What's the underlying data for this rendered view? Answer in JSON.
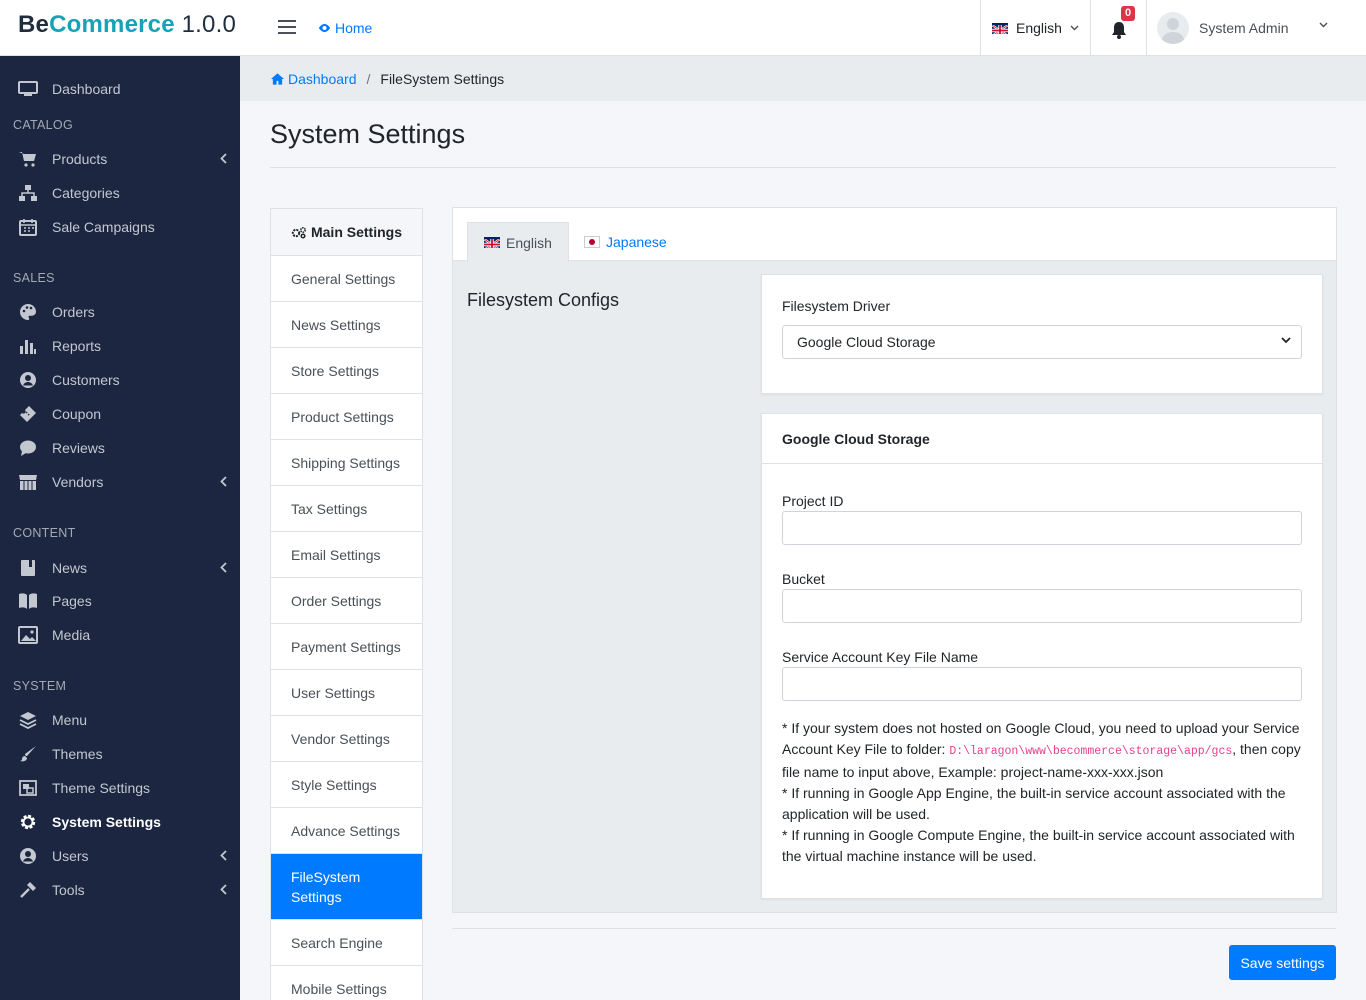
{
  "brand": {
    "name_1": "Be",
    "name_2": "Commerce",
    "version": " 1.0.0"
  },
  "topnav": {
    "home": "Home",
    "language": "English",
    "notifications_count": "0",
    "user_name": "System Admin"
  },
  "breadcrumb": {
    "root": "Dashboard",
    "current": "FileSystem Settings"
  },
  "page_title": "System Settings",
  "sidebar": {
    "dashboard": "Dashboard",
    "catalog_head": "CATALOG",
    "products": "Products",
    "categories": "Categories",
    "sale_campaigns": "Sale Campaigns",
    "sales_head": "SALES",
    "orders": "Orders",
    "reports": "Reports",
    "customers": "Customers",
    "coupon": "Coupon",
    "reviews": "Reviews",
    "vendors": "Vendors",
    "content_head": "CONTENT",
    "news": "News",
    "pages": "Pages",
    "media": "Media",
    "system_head": "SYSTEM",
    "menu": "Menu",
    "themes": "Themes",
    "theme_settings": "Theme Settings",
    "system_settings": "System Settings",
    "users": "Users",
    "tools": "Tools"
  },
  "settings_menu": {
    "title": "Main Settings",
    "items": [
      "General Settings",
      "News Settings",
      "Store Settings",
      "Product Settings",
      "Shipping Settings",
      "Tax Settings",
      "Email Settings",
      "Order Settings",
      "Payment Settings",
      "User Settings",
      "Vendor Settings",
      "Style Settings",
      "Advance Settings",
      "FileSystem Settings",
      "Search Engine",
      "Mobile Settings"
    ]
  },
  "tabs": {
    "english": "English",
    "japanese": "Japanese"
  },
  "section_title": "Filesystem Configs",
  "driver": {
    "label": "Filesystem Driver",
    "value": "Google Cloud Storage"
  },
  "gcs": {
    "title": "Google Cloud Storage",
    "project_id_label": "Project ID",
    "project_id_value": "",
    "bucket_label": "Bucket",
    "bucket_value": "",
    "key_file_label": "Service Account Key File Name",
    "key_file_value": "",
    "note_1a": "* If your system does not hosted on Google Cloud, you need to upload your Service Account Key File to folder: ",
    "note_1_path": "D:\\laragon\\www\\becommerce\\storage\\app/gcs",
    "note_1b": ", then copy file name to input above, Example: project-name-xxx-xxx.json",
    "note_2": "* If running in Google App Engine, the built-in service account associated with the application will be used.",
    "note_3": "* If running in Google Compute Engine, the built-in service account associated with the virtual machine instance will be used."
  },
  "save_button": "Save settings",
  "colors": {
    "sidebar_bg": "#1c2640",
    "primary": "#007bff",
    "brand_accent": "#17a2b8",
    "badge": "#dc3545"
  }
}
